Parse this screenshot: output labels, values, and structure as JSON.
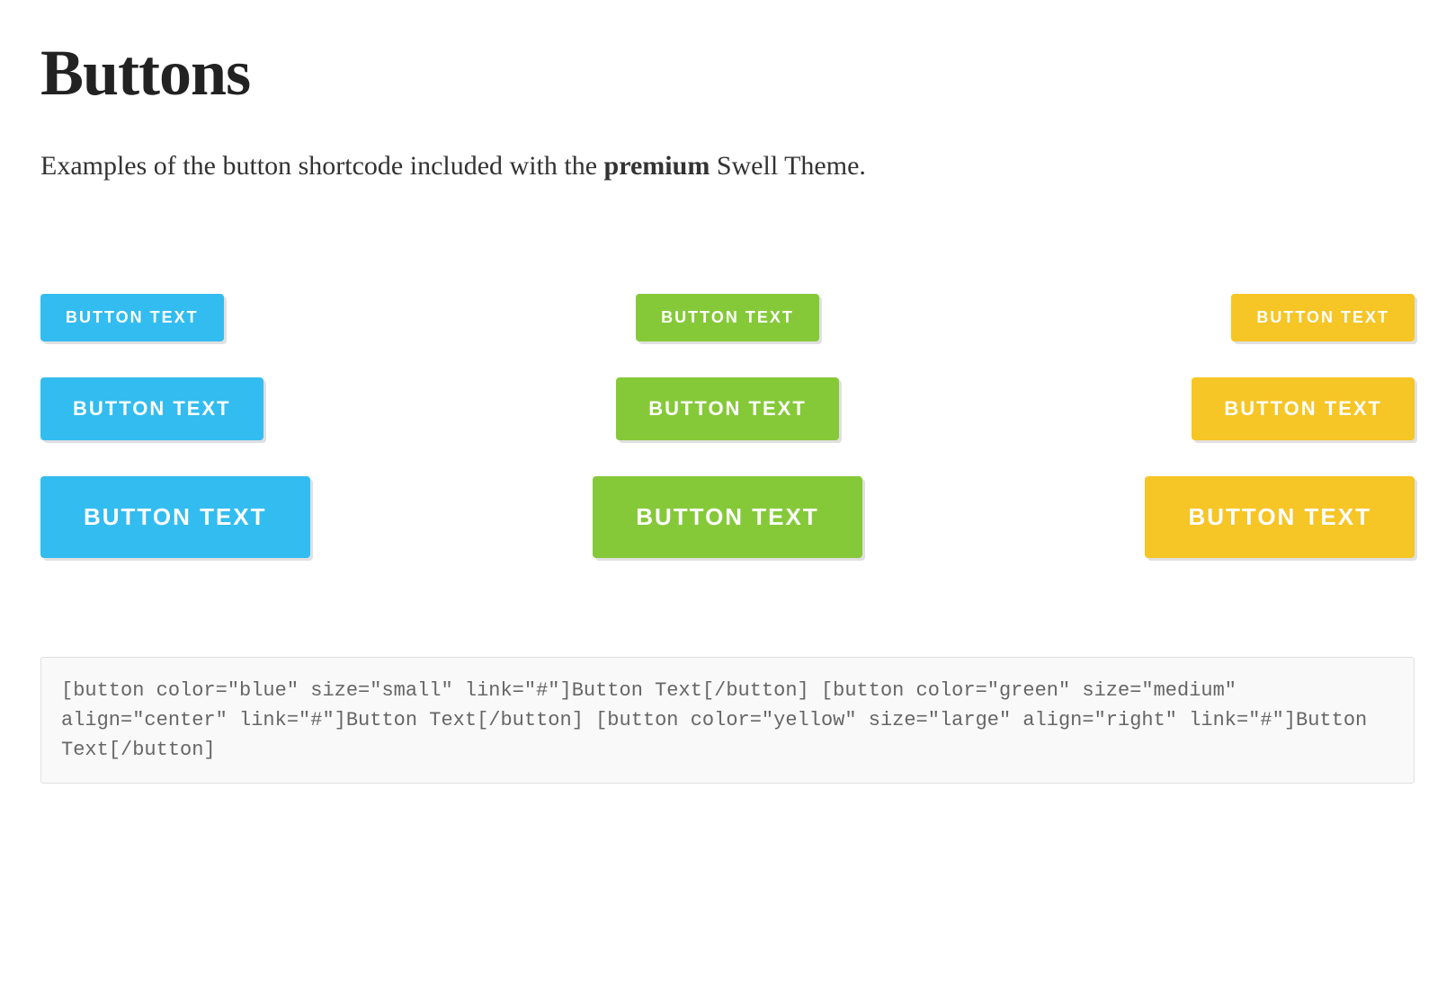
{
  "title": "Buttons",
  "intro_pre": "Examples of the button shortcode included with the ",
  "intro_strong": "premium",
  "intro_post": " Swell Theme.",
  "colors": {
    "blue": "#33bcef",
    "green": "#85c939",
    "yellow": "#f6c526"
  },
  "button_label": "BUTTON TEXT",
  "buttons": [
    {
      "color": "blue",
      "size": "small",
      "align": "left"
    },
    {
      "color": "green",
      "size": "small",
      "align": "center"
    },
    {
      "color": "yellow",
      "size": "small",
      "align": "right"
    },
    {
      "color": "blue",
      "size": "medium",
      "align": "left"
    },
    {
      "color": "green",
      "size": "medium",
      "align": "center"
    },
    {
      "color": "yellow",
      "size": "medium",
      "align": "right"
    },
    {
      "color": "blue",
      "size": "large",
      "align": "left"
    },
    {
      "color": "green",
      "size": "large",
      "align": "center"
    },
    {
      "color": "yellow",
      "size": "large",
      "align": "right"
    }
  ],
  "code": "[button color=\"blue\" size=\"small\" link=\"#\"]Button Text[/button] [button color=\"green\" size=\"medium\" align=\"center\" link=\"#\"]Button Text[/button] [button color=\"yellow\" size=\"large\" align=\"right\" link=\"#\"]Button Text[/button]"
}
